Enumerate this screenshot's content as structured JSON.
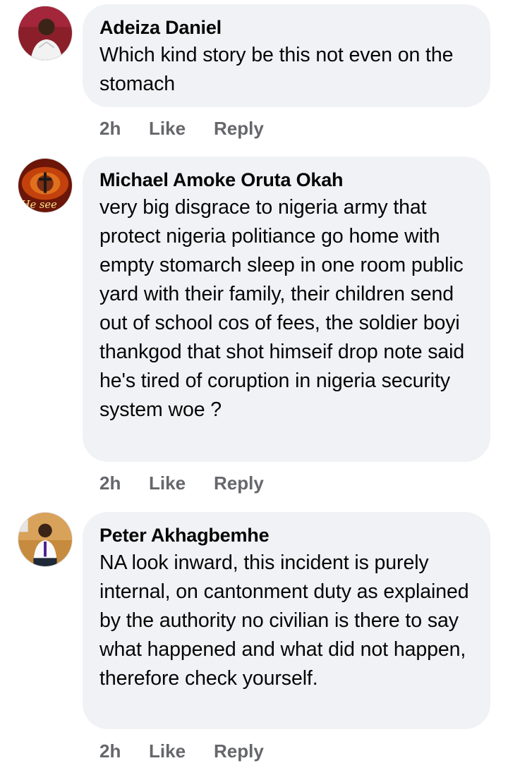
{
  "comments": [
    {
      "author": "Adeiza Daniel",
      "text": "Which kind story be this not even on the stomach",
      "time": "2h",
      "like_label": "Like",
      "reply_label": "Reply"
    },
    {
      "author": "Michael Amoke Oruta Okah",
      "text": "very big disgrace to nigeria army that protect nigeria politiance go home with empty stomarch sleep in one room public yard with their family, their children send out of school cos of fees, the soldier boyi thankgod that shot himseif drop note said he's tired of coruption in nigeria security system woe ?",
      "time": "2h",
      "like_label": "Like",
      "reply_label": "Reply",
      "avatar_text": "He see"
    },
    {
      "author": "Peter Akhagbemhe",
      "text": "NA look inward, this incident is purely internal, on cantonment duty as explained by the authority no civilian is there to say what happened and what did not happen, therefore check yourself.",
      "time": "2h",
      "like_label": "Like",
      "reply_label": "Reply"
    }
  ],
  "colors": {
    "bubble": "#f0f2f5",
    "meta": "#65676b",
    "text": "#050505"
  }
}
